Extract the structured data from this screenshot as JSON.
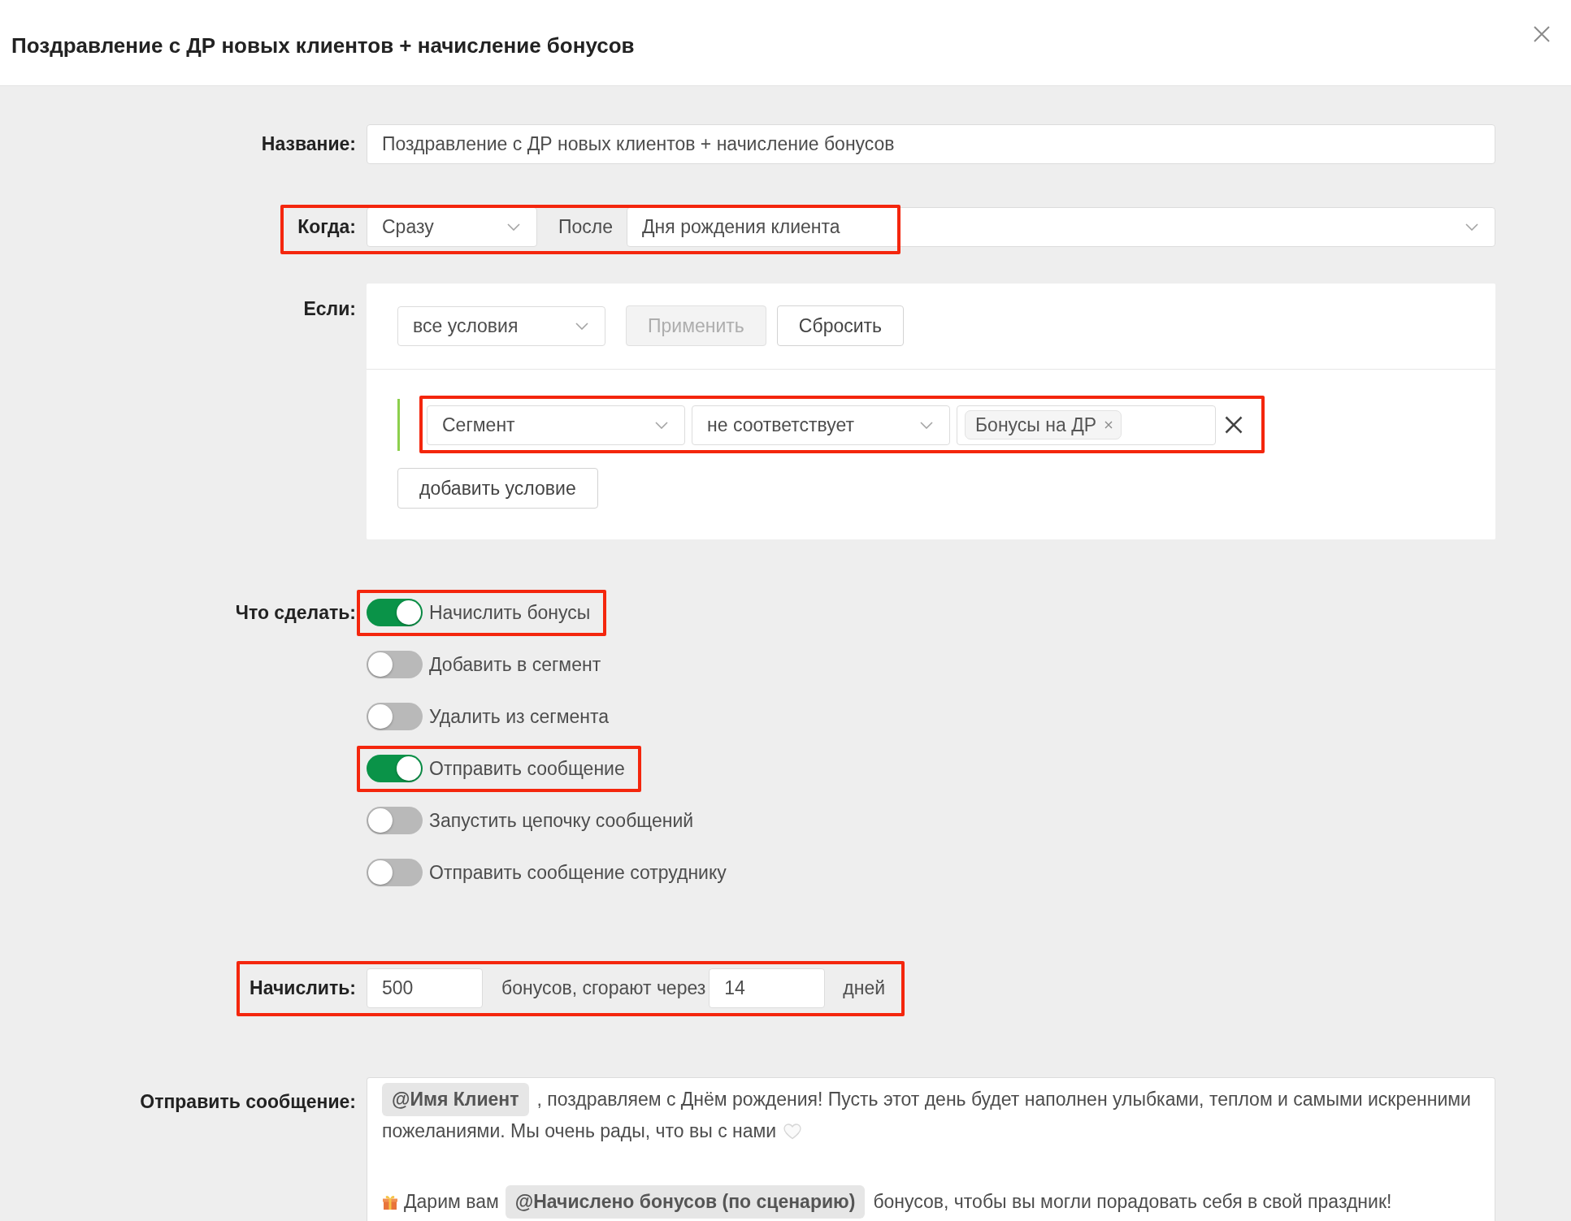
{
  "dialog": {
    "title": "Поздравление с ДР новых клиентов + начисление бонусов"
  },
  "name": {
    "label": "Название:",
    "value": "Поздравление с ДР новых клиентов + начисление бонусов"
  },
  "when": {
    "label": "Когда:",
    "timing": "Сразу",
    "connector": "После",
    "event": "Дня рождения клиента",
    "highlighted": true
  },
  "conditions": {
    "label": "Если:",
    "match": "все условия",
    "buttons": [
      {
        "label": "Применить",
        "disabled": true
      },
      {
        "label": "Сбросить",
        "disabled": false
      }
    ],
    "rules": [
      {
        "field": "Сегмент",
        "operator": "не соответствует",
        "tags": [
          "Бонусы на ДР"
        ],
        "highlighted": true
      }
    ],
    "add_button": "добавить условие"
  },
  "actions": {
    "label": "Что сделать:",
    "items": [
      {
        "label": "Начислить бонусы",
        "on": true,
        "highlighted": true
      },
      {
        "label": "Добавить в сегмент",
        "on": false,
        "highlighted": false
      },
      {
        "label": "Удалить из сегмента",
        "on": false,
        "highlighted": false
      },
      {
        "label": "Отправить сообщение",
        "on": true,
        "highlighted": true
      },
      {
        "label": "Запустить цепочку сообщений",
        "on": false,
        "highlighted": false
      },
      {
        "label": "Отправить сообщение сотруднику",
        "on": false,
        "highlighted": false
      }
    ]
  },
  "accrual": {
    "label": "Начислить:",
    "amount": "500",
    "text": "бонусов, сгорают через",
    "days": "14",
    "unit": "дней",
    "highlighted": true
  },
  "message": {
    "label": "Отправить сообщение:",
    "paragraphs": [
      {
        "lines": [
          [
            {
              "kind": "variable",
              "text": "@Имя Клиент"
            },
            {
              "kind": "text",
              "text": ", поздравляем с Днём рождения! Пусть этот день будет наполнен улыбками, теплом и самыми искренними"
            }
          ],
          [
            {
              "kind": "text",
              "text": "пожеланиями. Мы очень рады, что вы с нами"
            },
            {
              "kind": "heart"
            }
          ]
        ]
      },
      {
        "lines": [
          [
            {
              "kind": "gift"
            },
            {
              "kind": "text",
              "text": "Дарим вам"
            },
            {
              "kind": "variable",
              "text": "@Начислено бонусов (по сценарию)"
            },
            {
              "kind": "text",
              "text": "бонусов, чтобы вы могли порадовать себя в свой праздник!"
            }
          ]
        ]
      }
    ]
  }
}
